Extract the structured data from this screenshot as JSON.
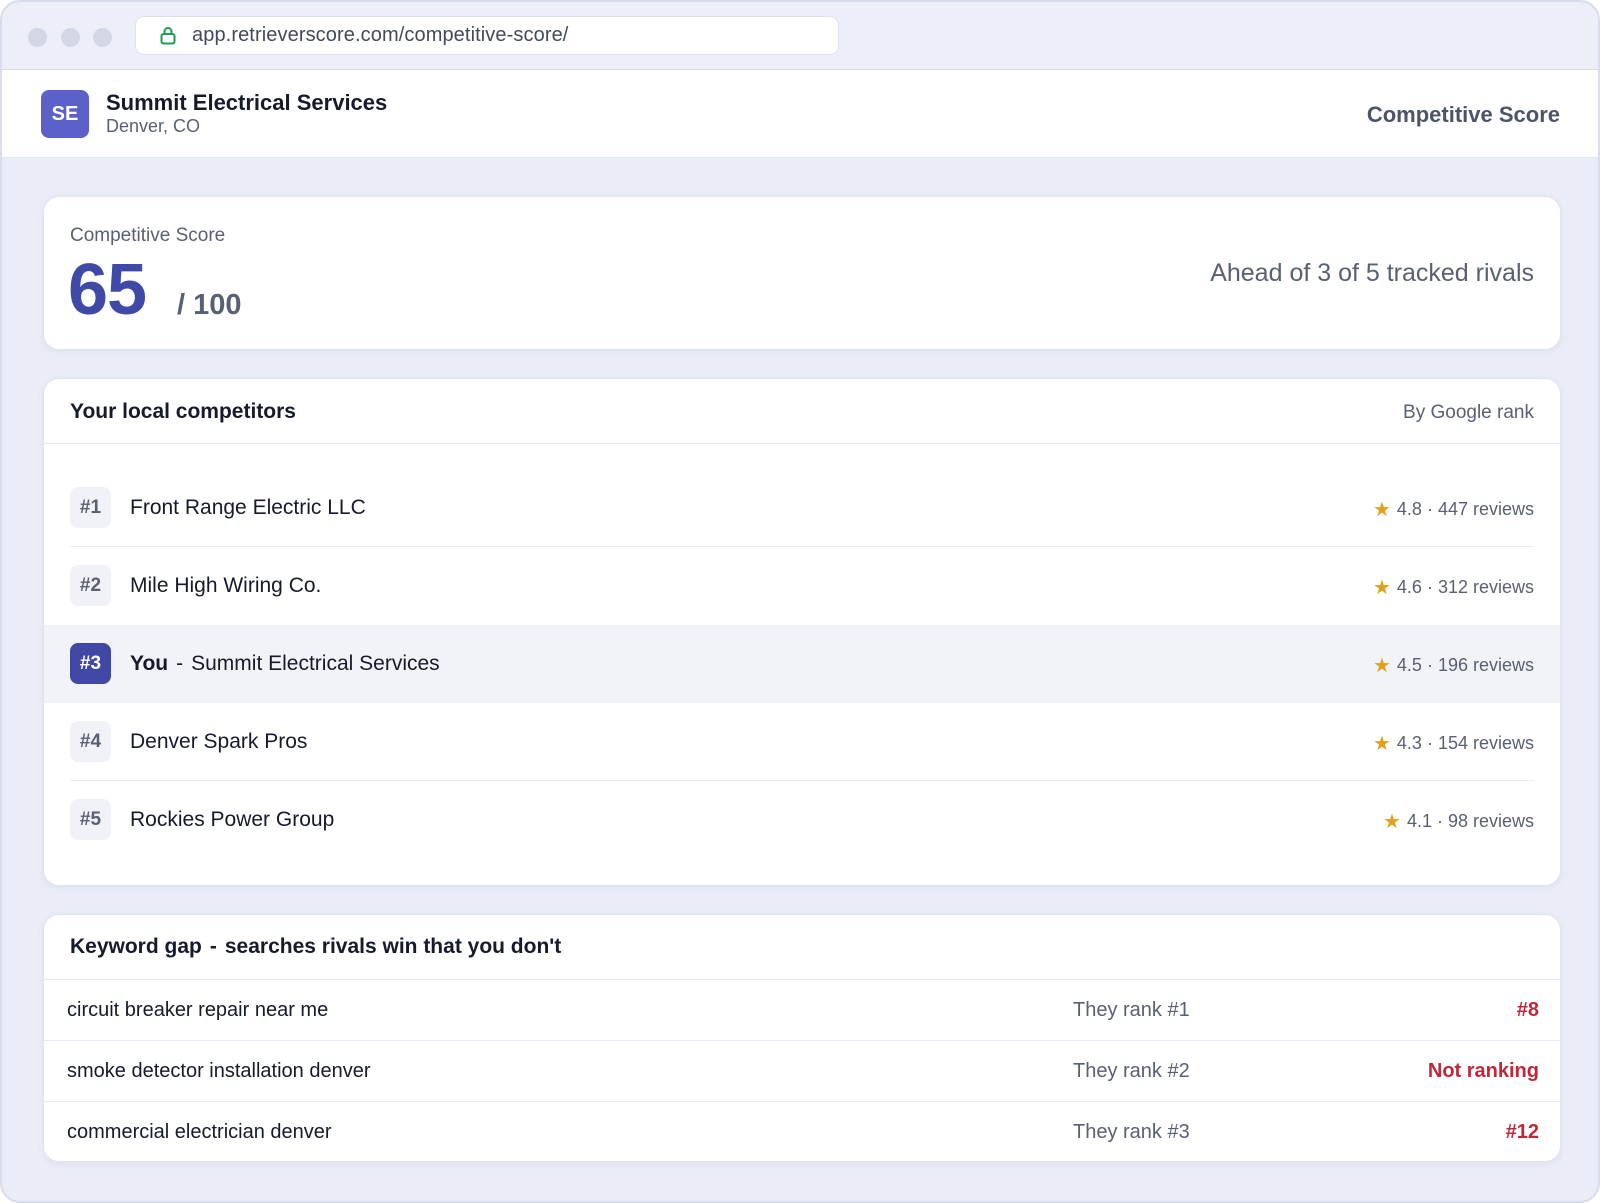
{
  "browser": {
    "url": "app.retrieverscore.com/competitive-score/"
  },
  "header": {
    "avatar_initials": "SE",
    "business_name": "Summit Electrical Services",
    "business_location": "Denver, CO",
    "page_title": "Competitive Score"
  },
  "score": {
    "label": "Competitive Score",
    "value": "65",
    "max": "/ 100",
    "rivals_text": "Ahead of 3 of 5 tracked rivals"
  },
  "competitors": {
    "title": "Your local competitors",
    "sort_label": "By Google rank",
    "you_label": "You",
    "separator": "-",
    "rows": [
      {
        "rank": "#1",
        "name": "Front Range Electric LLC",
        "rating": "4.8 · 447 reviews",
        "is_you": false
      },
      {
        "rank": "#2",
        "name": "Mile High Wiring Co.",
        "rating": "4.6 · 312 reviews",
        "is_you": false
      },
      {
        "rank": "#3",
        "name": "Summit Electrical Services",
        "rating": "4.5 · 196 reviews",
        "is_you": true
      },
      {
        "rank": "#4",
        "name": "Denver Spark Pros",
        "rating": "4.3 · 154 reviews",
        "is_you": false
      },
      {
        "rank": "#5",
        "name": "Rockies Power Group",
        "rating": "4.1 · 98 reviews",
        "is_you": false
      }
    ]
  },
  "keyword_gap": {
    "title_main": "Keyword gap",
    "separator": "-",
    "title_sub": "searches rivals win that you don't",
    "rows": [
      {
        "keyword": "circuit breaker repair near me",
        "their_rank": "They rank #1",
        "your_rank": "#8"
      },
      {
        "keyword": "smoke detector installation denver",
        "their_rank": "They rank #2",
        "your_rank": "Not ranking"
      },
      {
        "keyword": "commercial electrician denver",
        "their_rank": "They rank #3",
        "your_rank": "#12"
      }
    ]
  },
  "colors": {
    "accent": "#3e4aa6",
    "avatar": "#5b61c8",
    "star": "#e0a11f",
    "negative": "#c0283a"
  },
  "icons": {
    "lock": "lock-icon",
    "star": "star-icon"
  }
}
